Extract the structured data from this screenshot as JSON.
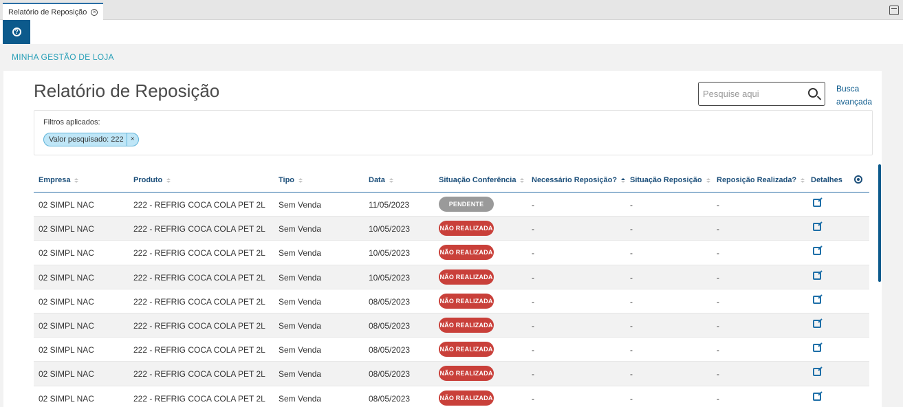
{
  "tab": {
    "label": "Relatório de Reposição"
  },
  "breadcrumb": "MINHA GESTÃO DE LOJA",
  "page_title": "Relatório de Reposição",
  "search": {
    "placeholder": "Pesquise aqui",
    "advanced_line1": "Busca",
    "advanced_line2": "avançada"
  },
  "filters": {
    "label": "Filtros aplicados:",
    "chip": "Valor pesquisado: 222"
  },
  "columns": [
    "Empresa",
    "Produto",
    "Tipo",
    "Data",
    "Situação Conferência",
    "Necessário Reposição?",
    "Situação Reposição",
    "Reposição Realizada?",
    "Detalhes"
  ],
  "rows": [
    {
      "empresa": "02 SIMPL NAC",
      "produto": "222 - REFRIG COCA COLA PET 2L",
      "tipo": "Sem Venda",
      "data": "11/05/2023",
      "situacao": "PENDENTE",
      "status": "pendente",
      "necessario": "-",
      "sit_reposicao": "-",
      "realizada": "-"
    },
    {
      "empresa": "02 SIMPL NAC",
      "produto": "222 - REFRIG COCA COLA PET 2L",
      "tipo": "Sem Venda",
      "data": "10/05/2023",
      "situacao": "NÃO REALIZADA",
      "status": "nao",
      "necessario": "-",
      "sit_reposicao": "-",
      "realizada": "-"
    },
    {
      "empresa": "02 SIMPL NAC",
      "produto": "222 - REFRIG COCA COLA PET 2L",
      "tipo": "Sem Venda",
      "data": "10/05/2023",
      "situacao": "NÃO REALIZADA",
      "status": "nao",
      "necessario": "-",
      "sit_reposicao": "-",
      "realizada": "-"
    },
    {
      "empresa": "02 SIMPL NAC",
      "produto": "222 - REFRIG COCA COLA PET 2L",
      "tipo": "Sem Venda",
      "data": "10/05/2023",
      "situacao": "NÃO REALIZADA",
      "status": "nao",
      "necessario": "-",
      "sit_reposicao": "-",
      "realizada": "-"
    },
    {
      "empresa": "02 SIMPL NAC",
      "produto": "222 - REFRIG COCA COLA PET 2L",
      "tipo": "Sem Venda",
      "data": "08/05/2023",
      "situacao": "NÃO REALIZADA",
      "status": "nao",
      "necessario": "-",
      "sit_reposicao": "-",
      "realizada": "-"
    },
    {
      "empresa": "02 SIMPL NAC",
      "produto": "222 - REFRIG COCA COLA PET 2L",
      "tipo": "Sem Venda",
      "data": "08/05/2023",
      "situacao": "NÃO REALIZADA",
      "status": "nao",
      "necessario": "-",
      "sit_reposicao": "-",
      "realizada": "-"
    },
    {
      "empresa": "02 SIMPL NAC",
      "produto": "222 - REFRIG COCA COLA PET 2L",
      "tipo": "Sem Venda",
      "data": "08/05/2023",
      "situacao": "NÃO REALIZADA",
      "status": "nao",
      "necessario": "-",
      "sit_reposicao": "-",
      "realizada": "-"
    },
    {
      "empresa": "02 SIMPL NAC",
      "produto": "222 - REFRIG COCA COLA PET 2L",
      "tipo": "Sem Venda",
      "data": "08/05/2023",
      "situacao": "NÃO REALIZADA",
      "status": "nao",
      "necessario": "-",
      "sit_reposicao": "-",
      "realizada": "-"
    },
    {
      "empresa": "02 SIMPL NAC",
      "produto": "222 - REFRIG COCA COLA PET 2L",
      "tipo": "Sem Venda",
      "data": "08/05/2023",
      "situacao": "NÃO REALIZADA",
      "status": "nao",
      "necessario": "-",
      "sit_reposicao": "-",
      "realizada": "-"
    }
  ],
  "colors": {
    "primary": "#0c5a8c",
    "pending": "#9a9a9a",
    "not_done": "#c9403a",
    "chip_bg": "#bfe6f7"
  },
  "icons": {
    "help": "help-icon",
    "tab_close": "close-circle-icon",
    "search": "search-icon",
    "settings": "gear-icon",
    "details": "external-link-icon"
  }
}
